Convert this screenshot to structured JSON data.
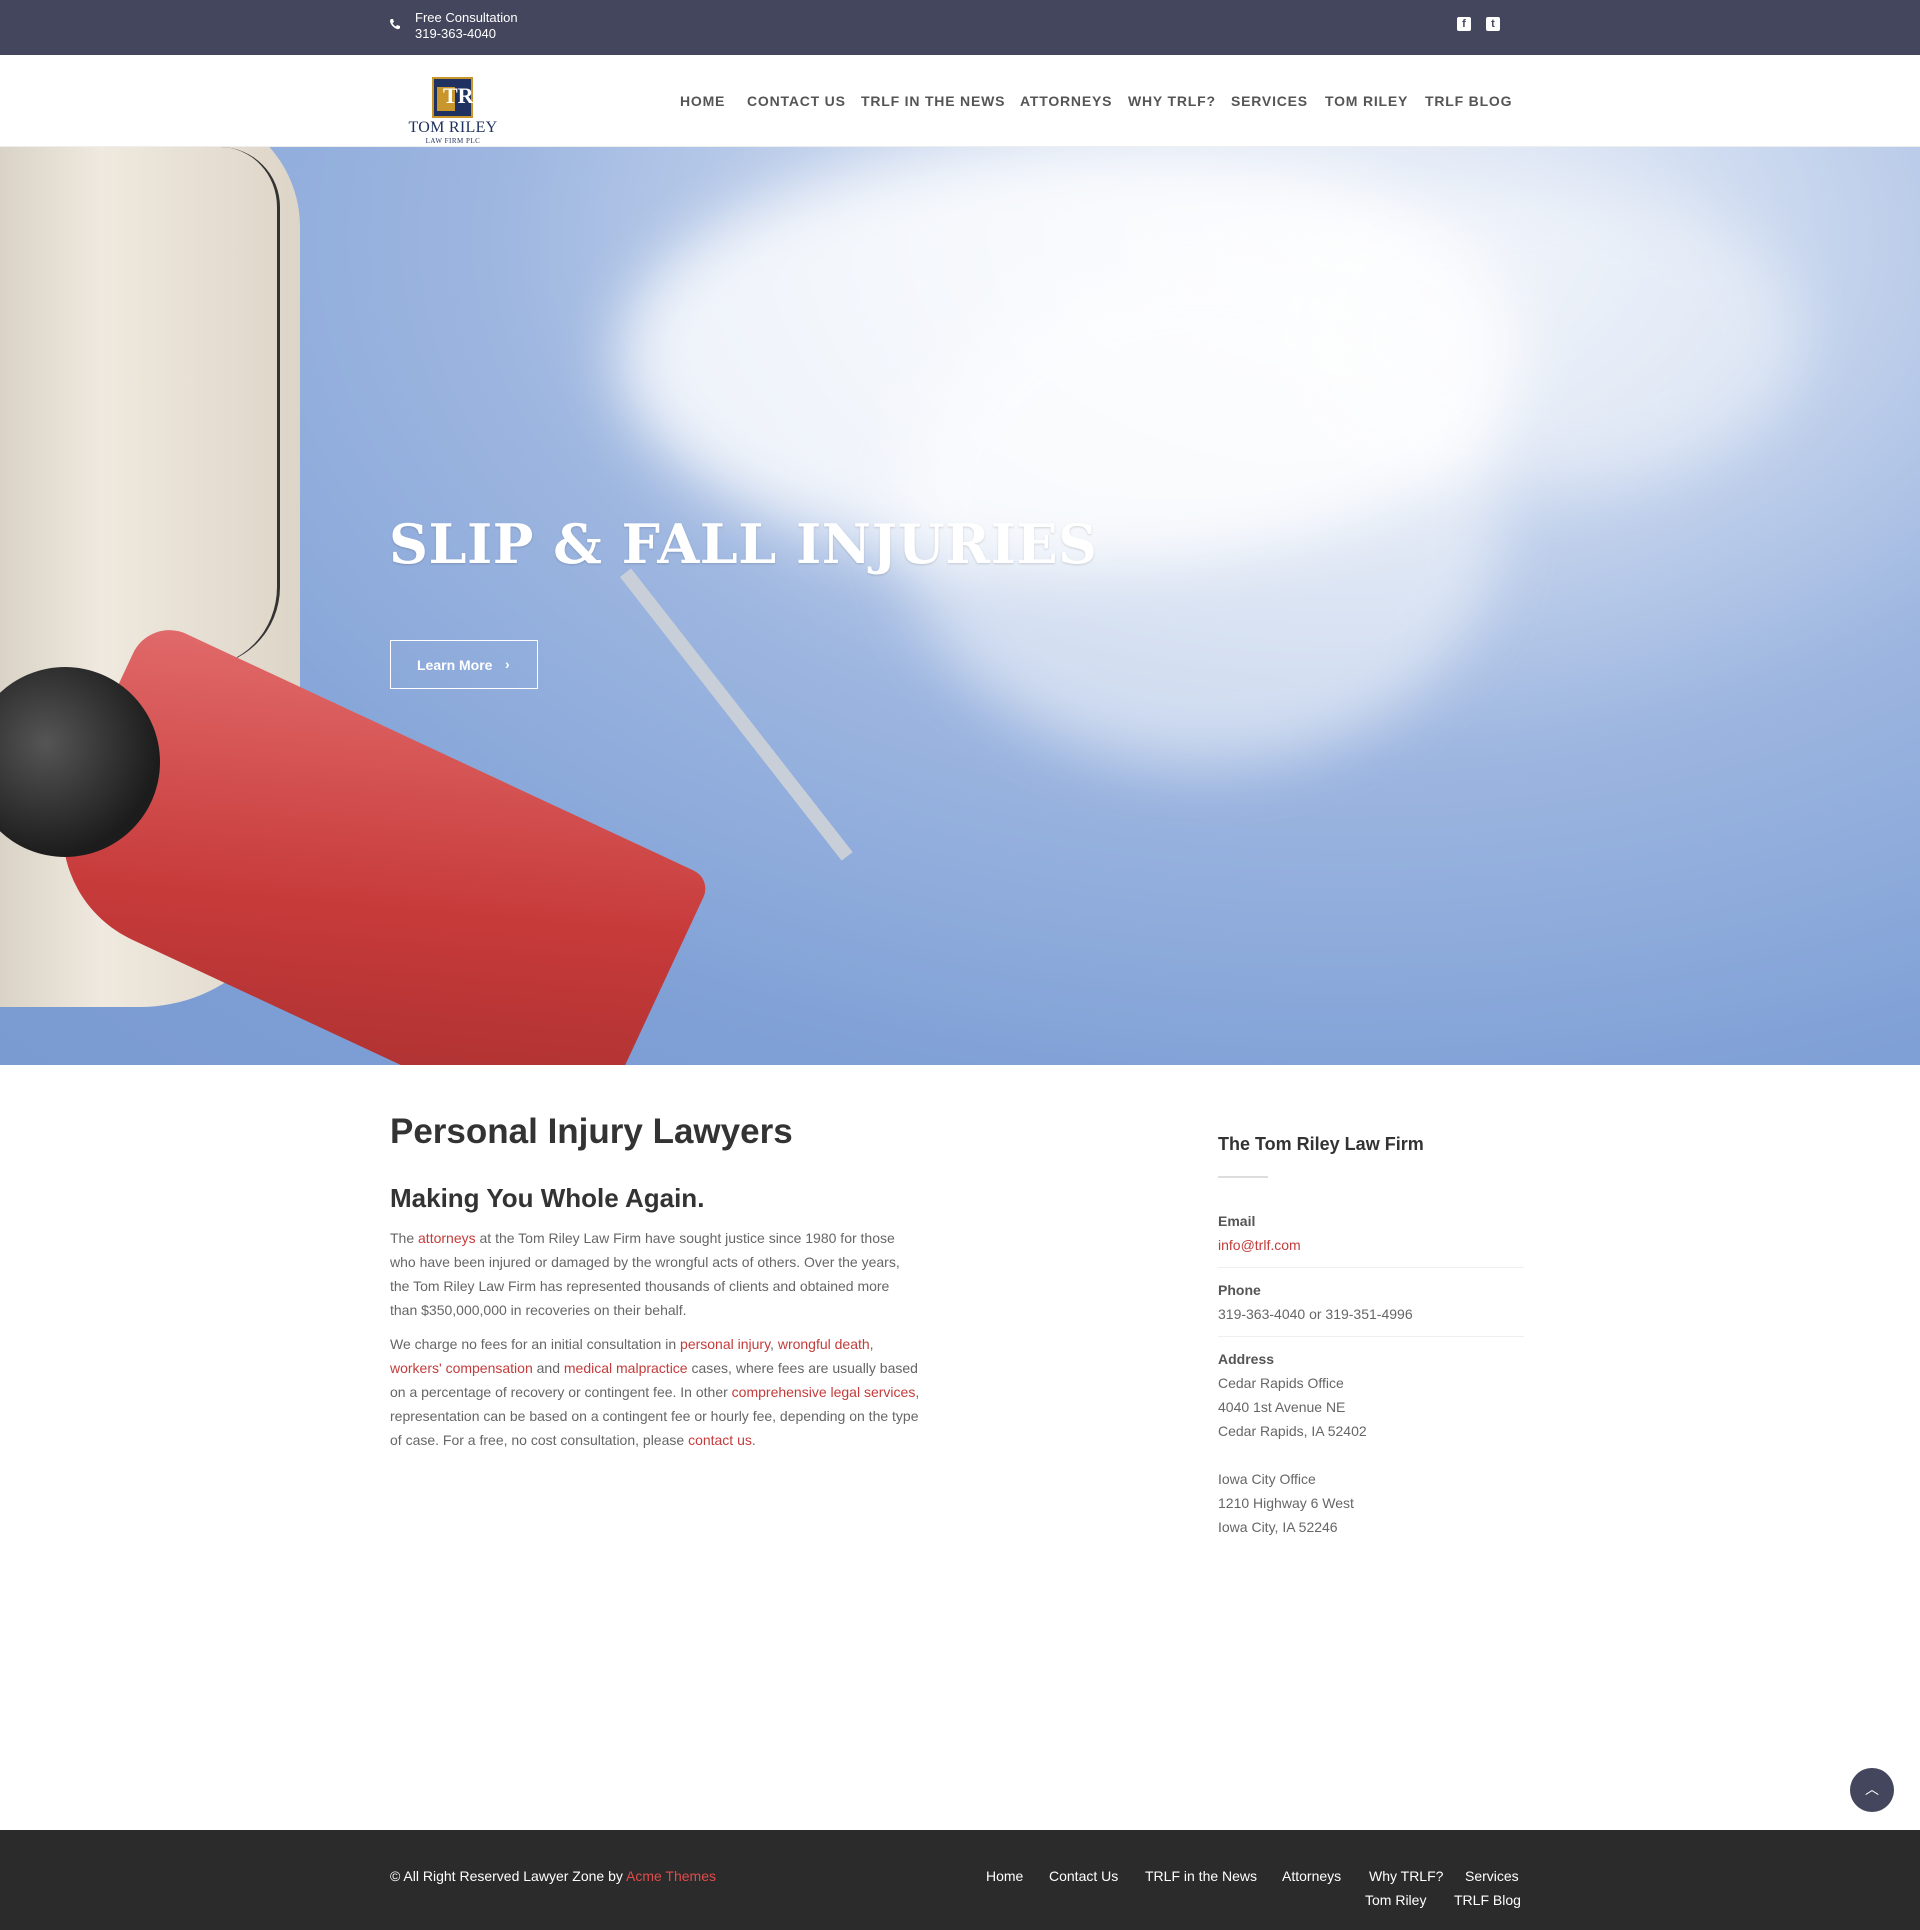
{
  "topbar": {
    "consult_label": "Free Consultation",
    "consult_phone": "319-363-4040",
    "facebook_icon": "facebook-icon",
    "twitter_icon": "twitter-icon"
  },
  "logo": {
    "mark": "TR",
    "name": "TOM RILEY",
    "sub": "LAW FIRM PLC"
  },
  "nav": [
    "HOME",
    "CONTACT US",
    "TRLF IN THE NEWS",
    "ATTORNEYS",
    "WHY TRLF?",
    "SERVICES",
    "TOM RILEY",
    "TRLF BLOG"
  ],
  "hero": {
    "title": "SLIP & FALL INJURIES",
    "button_label": "Learn More",
    "button_icon": "›"
  },
  "main": {
    "title": "Personal Injury Lawyers",
    "subtitle": "Making You Whole Again.",
    "p1": {
      "t1": "The ",
      "link1": "attorneys",
      "t2": " at the Tom Riley Law Firm have sought justice since 1980 for those who have been injured or damaged by the wrongful acts of others. Over the years, the Tom Riley Law Firm has represented thousands of clients and obtained more than $350,000,000 in recoveries on their behalf."
    },
    "p2": {
      "t1": "We charge no fees for an initial consultation in ",
      "link1": "personal injury",
      "t2": ", ",
      "link2": "wrongful death",
      "t3": ", ",
      "link3": "workers' compensation",
      "t4": " and ",
      "link4": "medical malpractice",
      "t5": " cases, where fees are usually based on a percentage of recovery or contingent fee. In other ",
      "link5": "comprehensive legal services",
      "t6": ", representation can be based on a contingent fee or hourly fee, depending on the type of case. For a free, no cost consultation, please ",
      "link6": "contact us",
      "t7": "."
    }
  },
  "sidebar": {
    "title": "The Tom Riley Law Firm",
    "email_label": "Email",
    "email": "info@trlf.com",
    "phone_label": "Phone",
    "phone": "319-363-4040 or 319-351-4996",
    "address_label": "Address",
    "office1": [
      "Cedar Rapids Office",
      "4040 1st Avenue NE",
      "Cedar Rapids, IA 52402"
    ],
    "office2": [
      "Iowa City Office",
      "1210 Highway 6 West",
      "Iowa City, IA 52246"
    ]
  },
  "back_to_top": "︿",
  "footer": {
    "copy_text": "© All Right Reserved Lawyer Zone by ",
    "copy_link": "Acme Themes",
    "links": [
      "Home",
      "Contact Us",
      "TRLF in the News",
      "Attorneys",
      "Why TRLF?",
      "Services",
      "Tom Riley",
      "TRLF Blog"
    ]
  },
  "colors": {
    "topbar": "#43465c",
    "accent_link": "#c43b3b",
    "footer": "#2b2b2b"
  }
}
